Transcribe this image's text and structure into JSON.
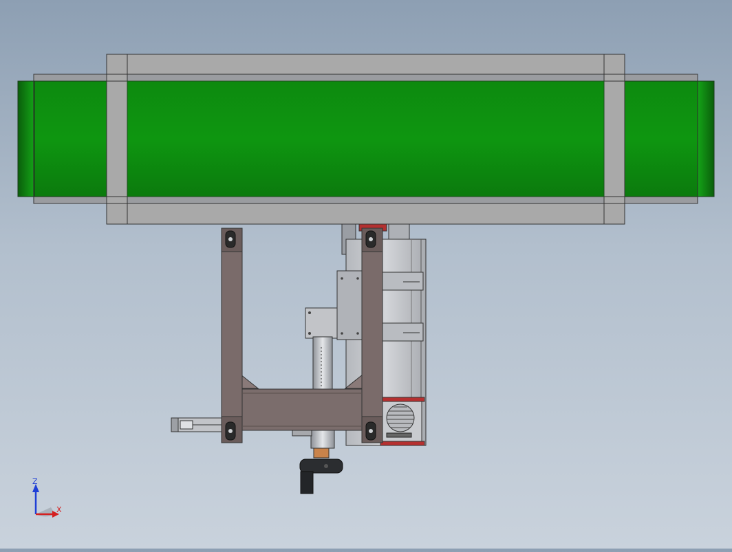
{
  "viewport": {
    "title": "",
    "background_top": "#8d9fb3",
    "background_bottom": "#c9d2dc"
  },
  "model": {
    "parts": [
      "conveyor-belt",
      "conveyor-frame",
      "support-frame",
      "crossbar",
      "linear-actuator",
      "column",
      "motor-housing",
      "cooling-fan",
      "foot-pad"
    ],
    "colors": {
      "belt": "#0e9610",
      "belt_dark": "#0a6e0c",
      "frame": "#a9a9a9",
      "support": "#7a6b6a",
      "housing": "#c5c7cb",
      "accent_red": "#c62828"
    }
  },
  "triad": {
    "z_label": "Z",
    "x_label": "X",
    "z_color": "#1f3fd6",
    "x_color": "#d42020"
  }
}
